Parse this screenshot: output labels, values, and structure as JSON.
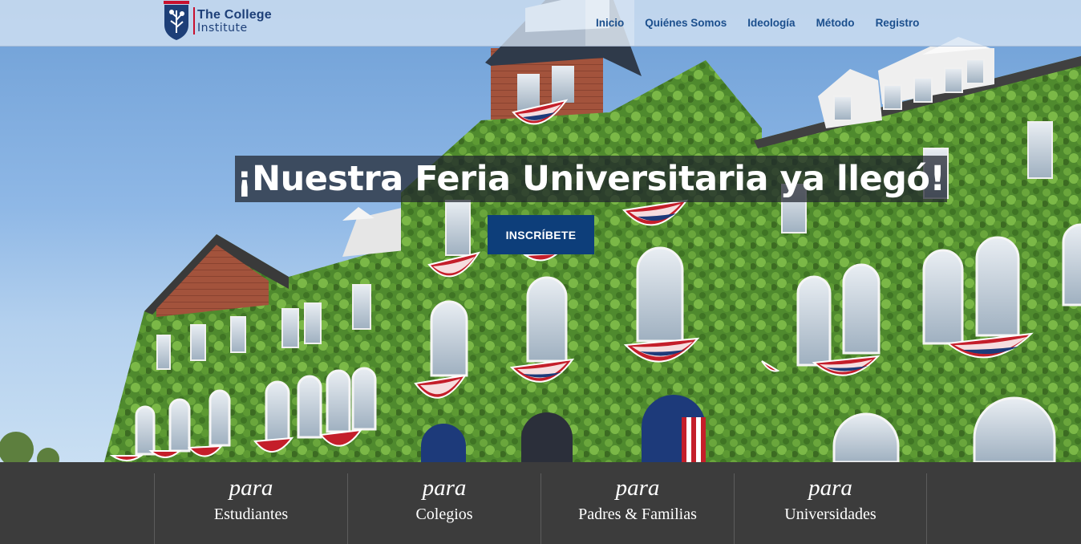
{
  "brand": {
    "name_line1": "The College",
    "name_line2": "Institute",
    "primary_color": "#1d3f78",
    "accent_color": "#c8102e"
  },
  "nav": {
    "items": [
      {
        "label": "Inicio",
        "active": true
      },
      {
        "label": "Quiénes Somos",
        "active": false
      },
      {
        "label": "Ideología",
        "active": false
      },
      {
        "label": "Método",
        "active": false
      },
      {
        "label": "Registro",
        "active": false
      }
    ]
  },
  "hero": {
    "headline": "¡Nuestra Feria Universitaria ya llegó!",
    "cta_label": "INSCRÍBETE",
    "cta_color": "#0d3e7a"
  },
  "audiences": {
    "prefix": "para",
    "items": [
      {
        "label": "Estudiantes"
      },
      {
        "label": "Colegios"
      },
      {
        "label": "Padres & Familias"
      },
      {
        "label": "Universidades"
      }
    ]
  }
}
